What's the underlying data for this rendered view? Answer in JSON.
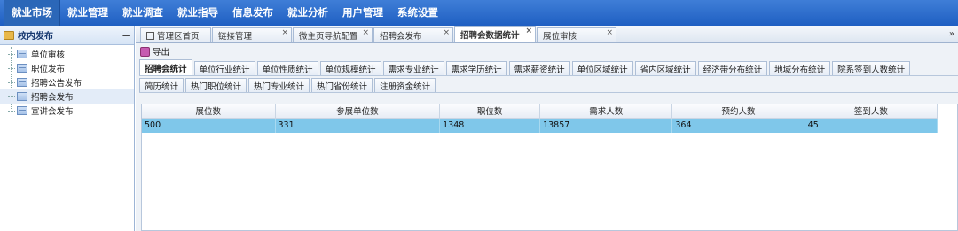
{
  "topnav": [
    "就业市场",
    "就业管理",
    "就业调查",
    "就业指导",
    "信息发布",
    "就业分析",
    "用户管理",
    "系统设置"
  ],
  "sidebar": {
    "title": "校内发布",
    "collapse": "−",
    "items": [
      "单位审核",
      "职位发布",
      "招聘公告发布",
      "招聘会发布",
      "宣讲会发布"
    ]
  },
  "tabs": [
    "管理区首页",
    "链接管理",
    "微主页导航配置",
    "招聘会发布",
    "招聘会数据统计",
    "展位审核"
  ],
  "tab_close": "×",
  "tab_more": "»",
  "toolbar": {
    "export": "导出"
  },
  "subtabs_row1": [
    "招聘会统计",
    "单位行业统计",
    "单位性质统计",
    "单位规模统计",
    "需求专业统计",
    "需求学历统计",
    "需求薪资统计",
    "单位区域统计",
    "省内区域统计",
    "经济带分布统计",
    "地域分布统计",
    "院系签到人数统计"
  ],
  "subtabs_row2": [
    "简历统计",
    "热门职位统计",
    "热门专业统计",
    "热门省份统计",
    "注册资金统计"
  ],
  "table": {
    "headers": [
      "展位数",
      "参展单位数",
      "职位数",
      "需求人数",
      "预约人数",
      "签到人数"
    ],
    "rows": [
      [
        "500",
        "331",
        "1348",
        "13857",
        "364",
        "45"
      ]
    ]
  }
}
